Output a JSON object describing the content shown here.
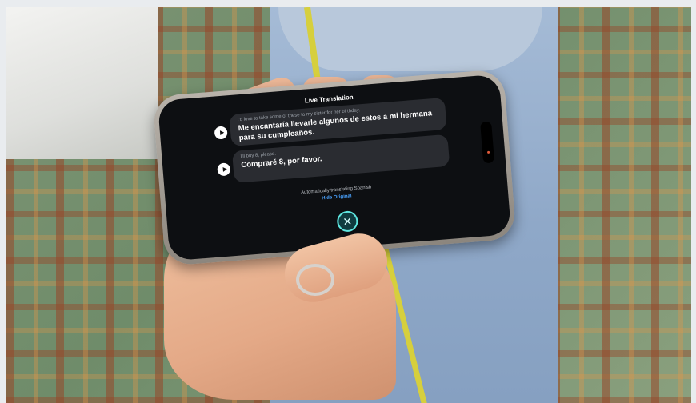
{
  "live_translation": {
    "title": "Live Translation",
    "messages": [
      {
        "original": "I'd love to take some of these to my sister for her birthday.",
        "translation": "Me encantaría llevarle algunos de estos a mi hermana para su cumpleaños."
      },
      {
        "original": "I'll buy 8, please.",
        "translation": "Compraré 8, por favor."
      }
    ],
    "status": "Automatically translating Spanish",
    "hide_original_label": "Hide Original",
    "close_symbol": "✕"
  },
  "colors": {
    "screen": "#0d0f12",
    "bubble": "#2a2c31",
    "link": "#4aa3ff",
    "close_ring": "#5ee6e0"
  }
}
